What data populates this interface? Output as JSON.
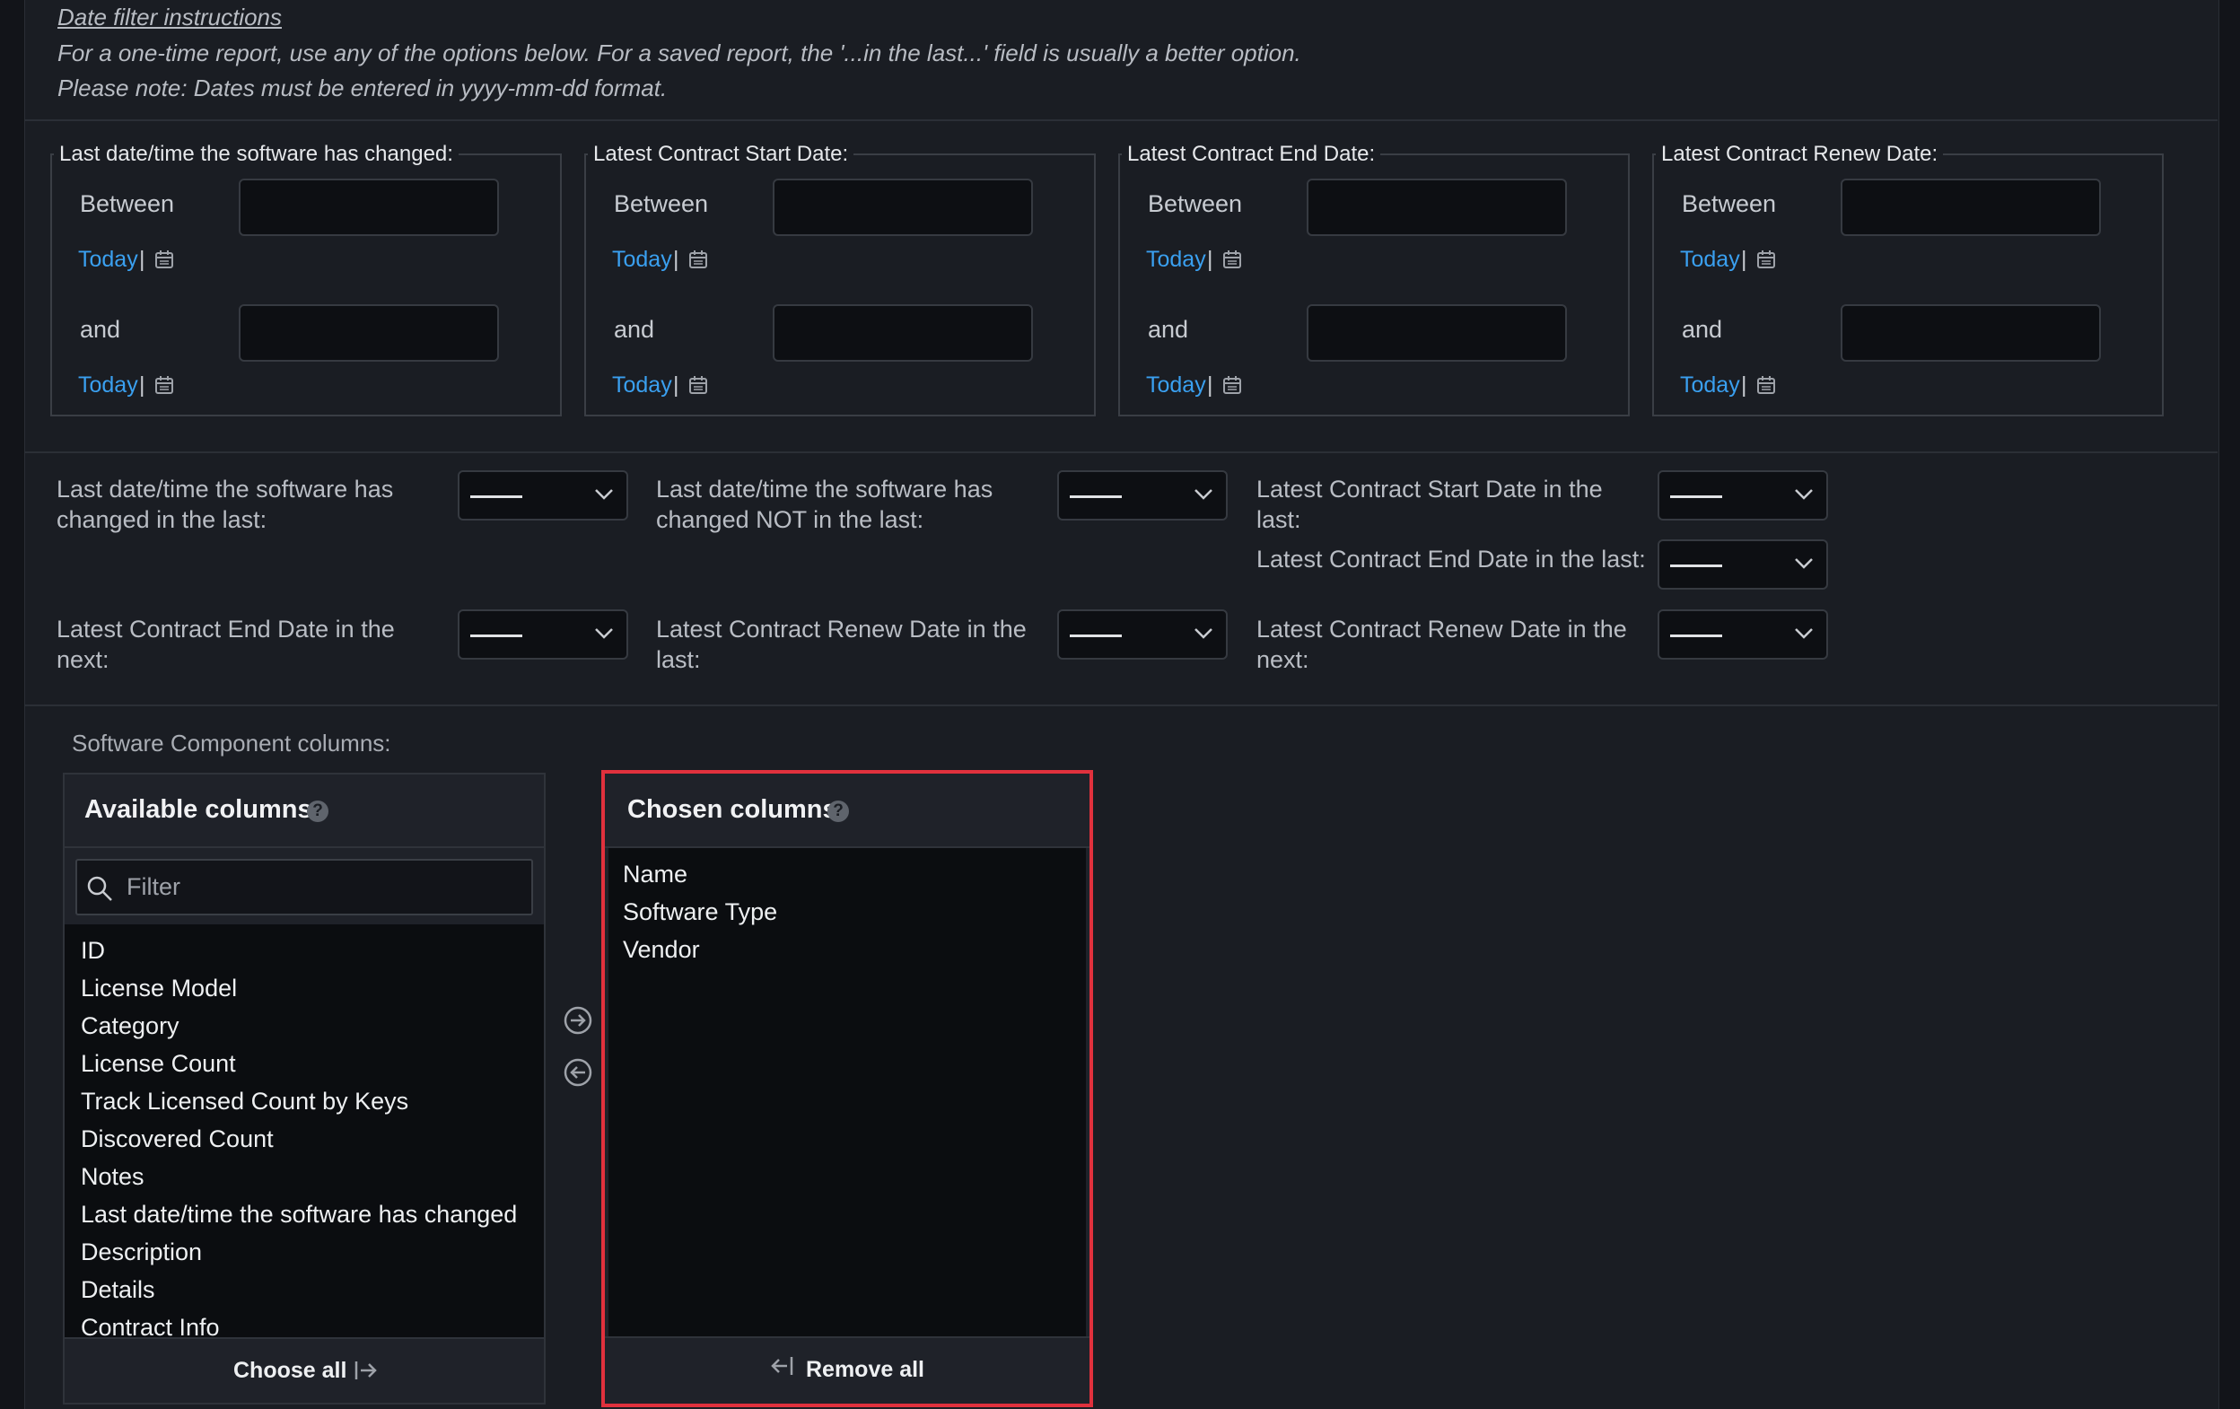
{
  "instructions": {
    "title": "Date filter instructions",
    "line1": "For a one-time report, use any of the options below. For a saved report, the '...in the last...' field is usually a better option.",
    "line2": "Please note: Dates must be entered in yyyy-mm-dd format."
  },
  "date_groups": [
    {
      "legend": "Last date/time the software has changed:",
      "between": "Between",
      "and": "and",
      "today": "Today",
      "sep": "|"
    },
    {
      "legend": "Latest Contract Start Date:",
      "between": "Between",
      "and": "and",
      "today": "Today",
      "sep": "|"
    },
    {
      "legend": "Latest Contract End Date:",
      "between": "Between",
      "and": "and",
      "today": "Today",
      "sep": "|"
    },
    {
      "legend": "Latest Contract Renew Date:",
      "between": "Between",
      "and": "and",
      "today": "Today",
      "sep": "|"
    }
  ],
  "relative_filters": [
    {
      "label": "Last date/time the software has changed in the last:",
      "value": "——"
    },
    {
      "label": "Last date/time the software has changed NOT in the last:",
      "value": "——"
    },
    {
      "label": "Latest Contract Start Date in the last:",
      "value": "——"
    },
    {
      "label": "Latest Contract End Date in the last:",
      "value": "——"
    },
    {
      "label": "Latest Contract End Date in the next:",
      "value": "——"
    },
    {
      "label": "Latest Contract Renew Date in the last:",
      "value": "——"
    },
    {
      "label": "Latest Contract Renew Date in the next:",
      "value": "——"
    }
  ],
  "columns_section": {
    "label": "Software Component columns:",
    "available": {
      "header": "Available columns",
      "filter_placeholder": "Filter",
      "items": [
        "ID",
        "License Model",
        "Category",
        "License Count",
        "Track Licensed Count by Keys",
        "Discovered Count",
        "Notes",
        "Last date/time the software has changed",
        "Description",
        "Details",
        "Contract Info"
      ],
      "choose_all": "Choose all"
    },
    "chosen": {
      "header": "Chosen columns",
      "items": [
        "Name",
        "Software Type",
        "Vendor"
      ],
      "remove_all": "Remove all"
    },
    "highlight_color": "#e0313d"
  },
  "colors": {
    "link": "#3aa0f0",
    "panel_bg": "#1a1d23",
    "input_bg": "#0d0f13"
  }
}
